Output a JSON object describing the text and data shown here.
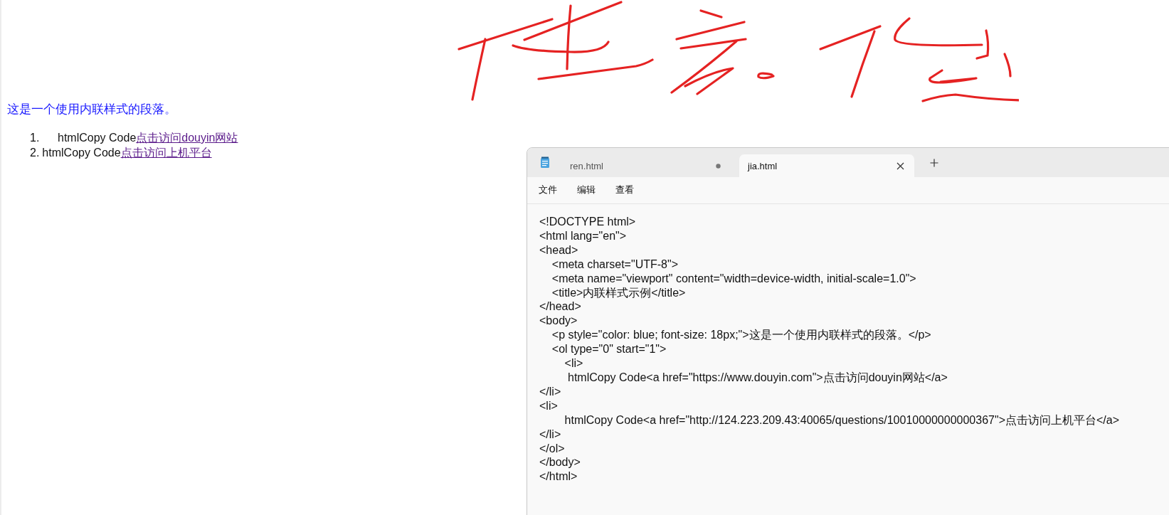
{
  "page": {
    "paragraph": "这是一个使用内联样式的段落。",
    "list": [
      {
        "kind": "spaced",
        "marker": "1.",
        "text": "htmlCopy Code",
        "link": "点击访问douyin网站"
      },
      {
        "kind": "plain",
        "marker": "2.",
        "text": "htmlCopy Code",
        "link": "点击访问上机平台"
      }
    ]
  },
  "notepad": {
    "tabs": [
      {
        "label": "ren.html",
        "selected": false,
        "unsaved": true
      },
      {
        "label": "jia.html",
        "selected": true,
        "unsaved": false
      }
    ],
    "menu": [
      "文件",
      "编辑",
      "查看"
    ],
    "code_lines": [
      "<!DOCTYPE html>",
      "<html lang=\"en\">",
      "<head>",
      "    <meta charset=\"UTF-8\">",
      "    <meta name=\"viewport\" content=\"width=device-width, initial-scale=1.0\">",
      "    <title>内联样式示例</title>",
      "</head>",
      "<body>",
      "    <p style=\"color: blue; font-size: 18px;\">这是一个使用内联样式的段落。</p>",
      "    <ol type=\"0\" start=\"1\">",
      "        <li>",
      "         htmlCopy Code<a href=\"https://www.douyin.com\">点击访问douyin网站</a>",
      "</li>",
      "<li>",
      "        htmlCopy Code<a href=\"http://124.223.209.43:40065/questions/10010000000000367\">点击访问上机平台</a>",
      "</li>",
      "</ol>",
      "</body>",
      "</html>"
    ]
  }
}
